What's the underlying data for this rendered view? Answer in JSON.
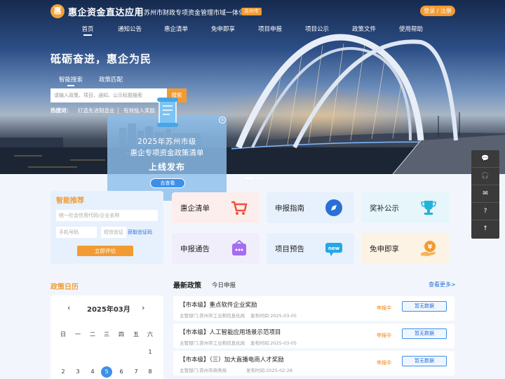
{
  "header": {
    "logo_glyph": "惠",
    "app_title": "惠企资金直达应用",
    "subtitle": "苏州市财政专项资金管理市域一体化",
    "city_badge": "苏州市",
    "login_label": "登录 / 注册"
  },
  "nav": {
    "items": [
      "首页",
      "通知公告",
      "惠企清单",
      "免申即享",
      "项目申报",
      "项目公示",
      "政策文件",
      "使用帮助"
    ],
    "active": "首页"
  },
  "hero": {
    "slogan": "砥砺奋进，惠企为民",
    "search_tabs": [
      "智能搜索",
      "政策匹配"
    ],
    "search_placeholder": "请输入政策、项目、通知、公示标题搜索",
    "search_button": "搜索",
    "hot_label": "热搜词：",
    "hot_words": [
      "打造先进制造业",
      "有效投入奖励"
    ]
  },
  "popup": {
    "line1": "2025年苏州市级",
    "line2": "惠企专项资金政策清单",
    "line3": "上线发布",
    "button": "去查看",
    "close": "×"
  },
  "side_toolbar": {
    "icons": [
      "chat-icon",
      "service-icon",
      "message-icon",
      "help-icon",
      "back-to-top-icon"
    ],
    "glyphs": [
      "💬",
      "🎧",
      "✉",
      "?",
      "↑"
    ]
  },
  "smart": {
    "title": "智能推荐",
    "credit_placeholder": "统一社会信用代码/企业名称",
    "phone_placeholder": "手机号码",
    "code_placeholder": "短信验证",
    "get_code": "获取验证码",
    "eval_button": "立即评估"
  },
  "tiles": [
    {
      "label": "惠企清单",
      "icon": "cart-icon",
      "bg": "#fdeeee"
    },
    {
      "label": "申报指南",
      "icon": "compass-icon",
      "bg": "#e7f1fd"
    },
    {
      "label": "奖补公示",
      "icon": "trophy-icon",
      "bg": "#e6f6fb"
    },
    {
      "label": "申报通告",
      "icon": "notice-icon",
      "bg": "#f1eefb"
    },
    {
      "label": "项目预告",
      "icon": "new-badge-icon",
      "bg": "#e7f1fd"
    },
    {
      "label": "免申即享",
      "icon": "coin-hand-icon",
      "bg": "#fdf3e4"
    }
  ],
  "calendar": {
    "section_title": "政策日历",
    "month": "2025年03月",
    "prev": "‹",
    "next": "›",
    "weekdays": [
      "日",
      "一",
      "二",
      "三",
      "四",
      "五",
      "六"
    ],
    "visible_days": [
      "1",
      "2",
      "3",
      "4",
      "5",
      "6",
      "7",
      "8"
    ],
    "today": "5"
  },
  "news": {
    "tabs": [
      "最新政策",
      "今日申报"
    ],
    "more": "查看更多>",
    "items": [
      {
        "title": "【市本级】重点软件企业奖励",
        "dept": "主管部门:苏州市工业和信息化局",
        "date": "发布时间:2025-03-05",
        "status": "申报中",
        "button": "暂无数据"
      },
      {
        "title": "【市本级】人工智能应用场景示范项目",
        "dept": "主管部门:苏州市工业和信息化局",
        "date": "发布时间:2025-03-05",
        "status": "申报中",
        "button": "暂无数据"
      },
      {
        "title": "【市本级】（三）加大直播电商人才奖励",
        "dept": "主管部门:苏州市商务局",
        "date": "发布时间:2025-02-28",
        "status": "申报中",
        "button": "暂无数据"
      }
    ]
  },
  "colors": {
    "accent_orange": "#f29b32",
    "link_blue": "#2a6fd6",
    "today_blue": "#3d8fe8",
    "section_orange": "#f29b32"
  }
}
